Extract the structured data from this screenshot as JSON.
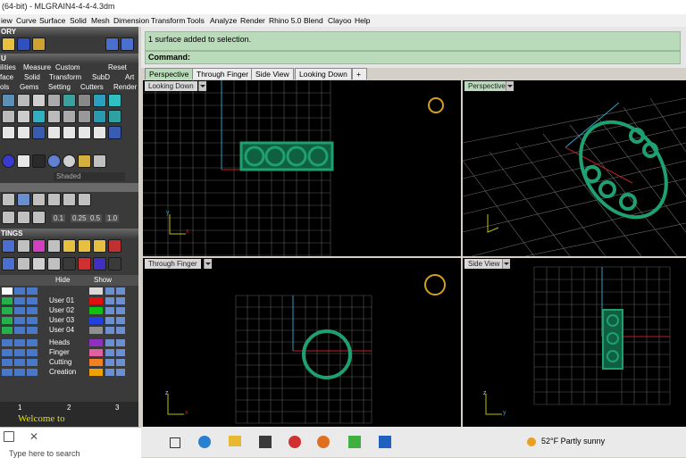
{
  "window": {
    "title": "(64-bit) - MLGRAIN4-4-4-4.3dm"
  },
  "menu": [
    "iew",
    "Curve",
    "Surface",
    "Solid",
    "Mesh",
    "Dimension",
    "Transform",
    "Tools",
    "Analyze",
    "Render",
    "Rhino 5.0",
    "Blend",
    "Clayoo",
    "Help"
  ],
  "left_panel": {
    "history_header": "ORY",
    "tools_header": "U",
    "tab_row": [
      "ilities",
      "Measure",
      "Custom",
      "Reset"
    ],
    "tools_row1": [
      "face",
      "Solid",
      "Transform",
      "SubD",
      "Art"
    ],
    "tools_row2": [
      "ols",
      "Gems",
      "Setting",
      "Cutters",
      "Render"
    ],
    "shaded_label": "Shaded",
    "num_labels": [
      "0.1",
      "0.25",
      "0.5",
      "1.0"
    ],
    "settings_header": "TINGS",
    "layers_hide": "Hide",
    "layers_show": "Show",
    "layers": [
      {
        "name": "",
        "swatch": "#d9d9d9",
        "color": "#ffffff"
      },
      {
        "name": "User 01",
        "swatch": "#e01010",
        "color": "#22b14c"
      },
      {
        "name": "User 02",
        "swatch": "#10c010",
        "color": "#22b14c"
      },
      {
        "name": "User 03",
        "swatch": "#2040e0",
        "color": "#22b14c"
      },
      {
        "name": "User 04",
        "swatch": "#909090",
        "color": "#22b14c"
      },
      {
        "name": "Heads",
        "swatch": "#9030c0",
        "color": "#4a78c8"
      },
      {
        "name": "Finger",
        "swatch": "#e060a0",
        "color": "#4a78c8"
      },
      {
        "name": "Cutting",
        "swatch": "#f08020",
        "color": "#4a78c8"
      },
      {
        "name": "Creation",
        "swatch": "#f0a000",
        "color": "#4a78c8"
      }
    ],
    "bottom_nums": [
      "1",
      "2",
      "3"
    ],
    "welcome_text": "Welcome to"
  },
  "command": {
    "status": "1 surface added to selection.",
    "label": "Command:"
  },
  "tabs": [
    "Perspective",
    "Through Finger",
    "Side View",
    "Looking Down"
  ],
  "viewports": {
    "top_left": "Looking Down",
    "top_right": "Perspective",
    "bottom_left": "Through Finger",
    "bottom_right": "Side View"
  },
  "axes": {
    "x": "x",
    "y": "y",
    "z": "z"
  },
  "taskbar": {
    "search_placeholder": "Type here to search",
    "weather": "52°F  Partly sunny"
  },
  "colors": {
    "ring_green": "#1fa070",
    "grid": "#5a5a5a",
    "accent_green": "#b9dbb9"
  }
}
